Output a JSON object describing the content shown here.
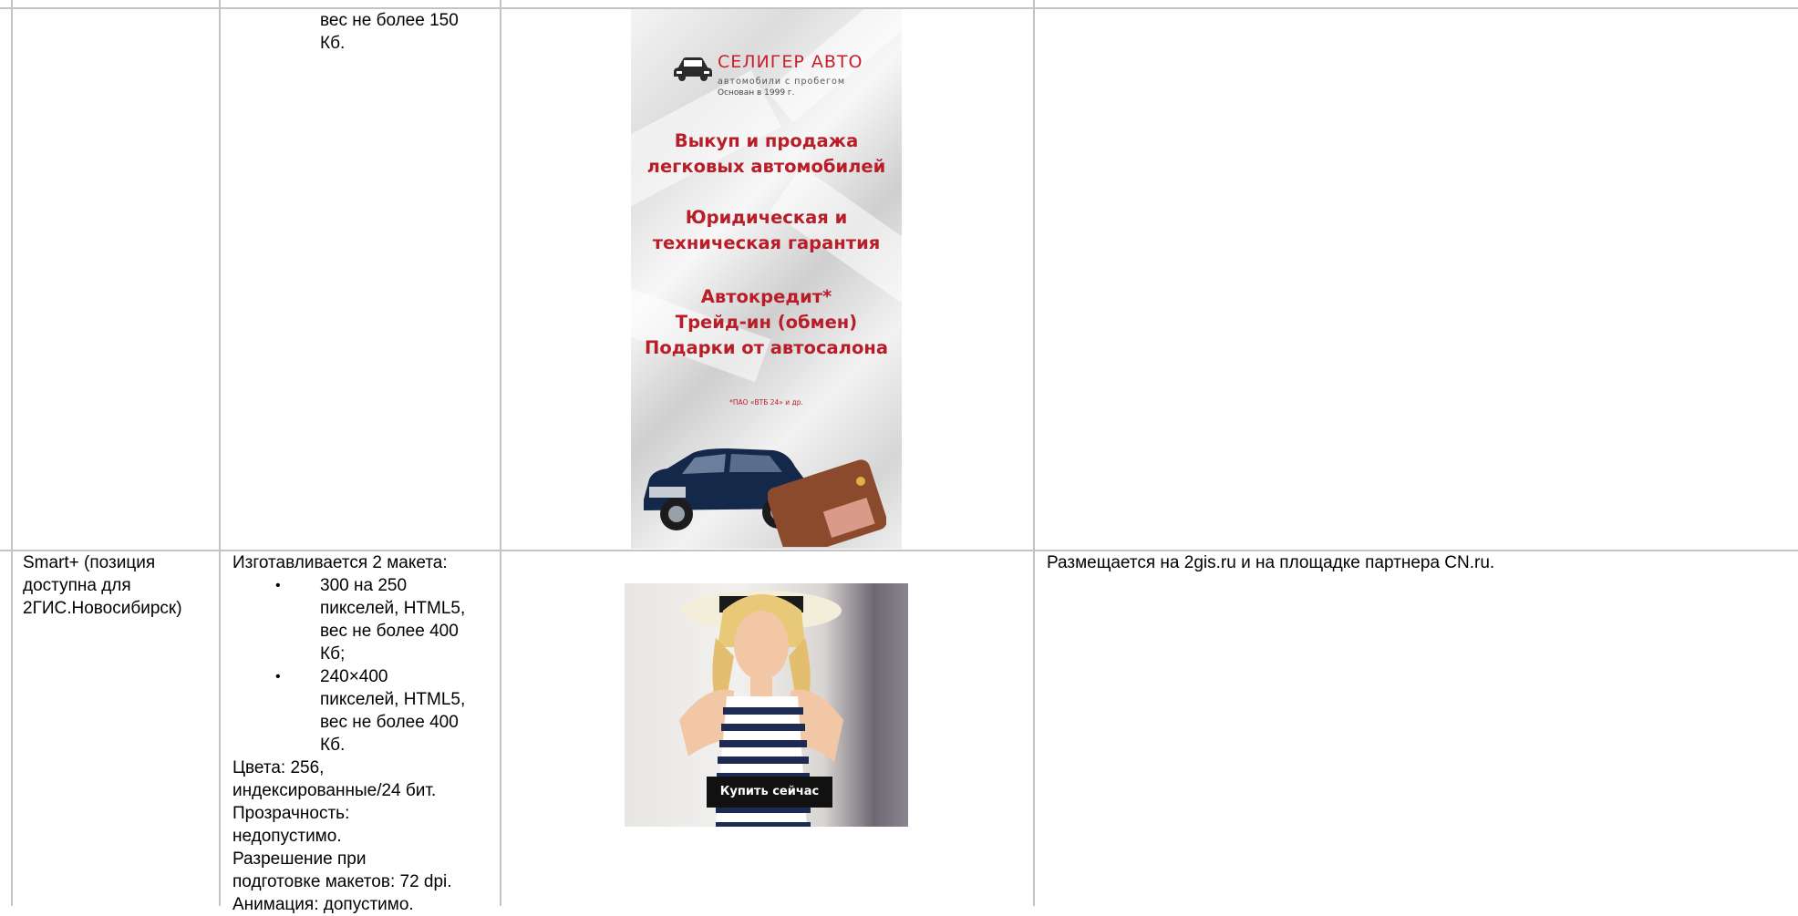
{
  "row1": {
    "requirements_tail": [
      "вес не более 150",
      "Кб."
    ]
  },
  "banner1": {
    "brand": "СЕЛИГЕР АВТО",
    "tagline": "автомобили с пробегом",
    "founded": "Основан в 1999 г.",
    "lines_a": [
      "Выкуп и продажа",
      "легковых автомобилей"
    ],
    "lines_b": [
      "Юридическая и",
      "техническая гарантия"
    ],
    "lines_c": [
      "Автокредит*",
      "Трейд-ин (обмен)",
      "Подарки от автосалона"
    ],
    "footnote": "*ПАО «ВТБ 24» и др."
  },
  "row2": {
    "position": [
      "Smart+ (позиция",
      "доступна для",
      "2ГИС.Новосибирск)"
    ],
    "intro": "Изготавливается 2 макета:",
    "bullets": [
      [
        "300 на 250",
        "пикселей, HTML5,",
        "вес не более 400",
        "Кб;"
      ],
      [
        "240×400",
        "пикселей, HTML5,",
        "вес не более 400",
        "Кб."
      ]
    ],
    "specs": [
      "Цвета: 256,",
      "индексированные/24 бит.",
      "Прозрачность:",
      "недопустимо.",
      "Разрешение при",
      "подготовке макетов: 72 dpi.",
      "Анимация: допустимо."
    ],
    "placement": "Размещается на 2gis.ru и на площадке партнера CN.ru.",
    "banner_button": "Купить сейчас"
  }
}
